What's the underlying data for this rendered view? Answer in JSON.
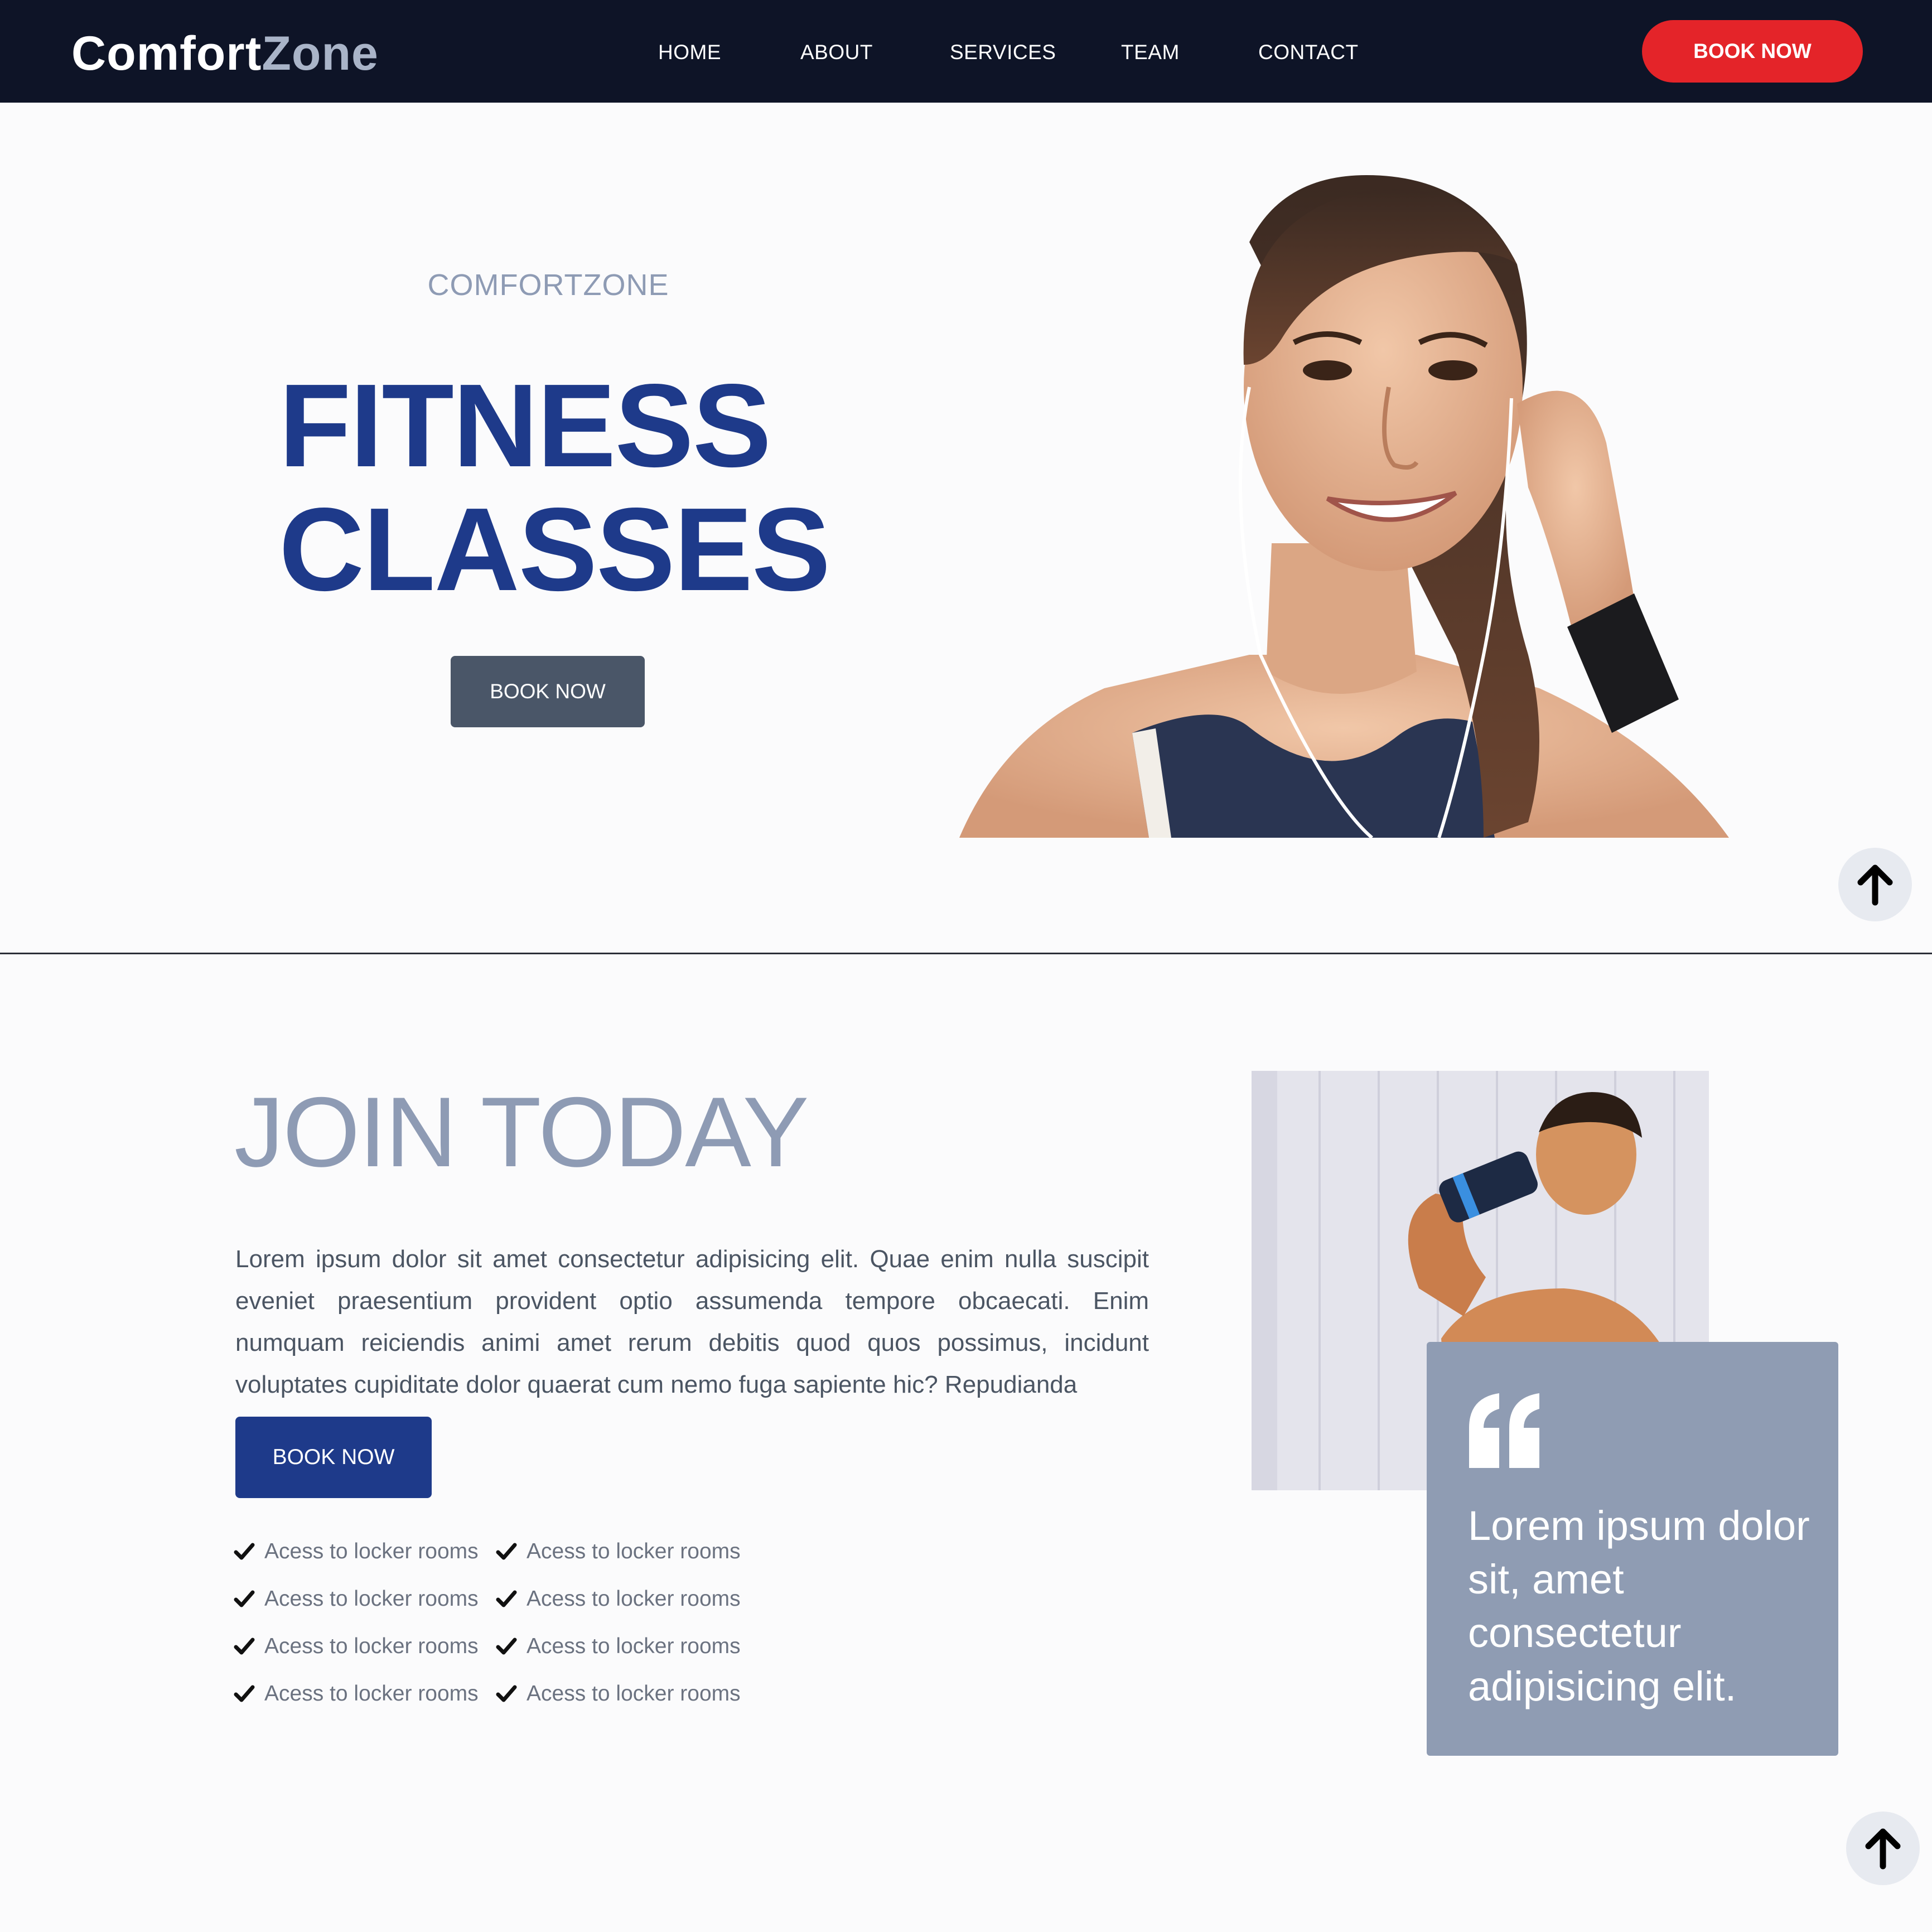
{
  "brand": {
    "part1": "Comfort",
    "part2": "Zone"
  },
  "nav": {
    "links": [
      "HOME",
      "ABOUT",
      "SERVICES",
      "TEAM",
      "CONTACT"
    ],
    "book_label": "BOOK NOW"
  },
  "hero": {
    "eyebrow": "COMFORTZONE",
    "title_line1": "FITNESS",
    "title_line2": "CLASSES",
    "button_label": "BOOK NOW",
    "image_icon": "woman-with-earphones-photo"
  },
  "join": {
    "title": "JOIN TODAY",
    "text": "Lorem ipsum dolor sit amet consectetur adipisicing elit. Quae enim nulla suscipit eveniet praesentium provident optio assumenda tempore obcaecati. Enim numquam reiciendis animi amet rerum debitis quod quos possimus, incidunt voluptates cupiditate dolor quaerat cum nemo fuga sapiente hic? Repudianda",
    "button_label": "BOOK NOW",
    "features": [
      "Acess to locker rooms",
      "Acess to locker rooms",
      "Acess to locker rooms",
      "Acess to locker rooms",
      "Acess to locker rooms",
      "Acess to locker rooms",
      "Acess to locker rooms",
      "Acess to locker rooms"
    ],
    "quote": "Lorem ipsum dolor sit, amet consectetur adipisicing elit.",
    "image_icon": "man-drinking-from-shaker-photo"
  },
  "colors": {
    "navbar_bg": "#0e1427",
    "accent_red": "#e42429",
    "primary_blue": "#1e3a8a",
    "muted_slate": "#8e9bb4",
    "hero_button": "#4a5668",
    "quote_card": "#8f9cb3"
  },
  "icons": {
    "scroll_top": "arrow-up-icon",
    "check": "checkmark-icon",
    "quote": "quote-mark-icon"
  }
}
